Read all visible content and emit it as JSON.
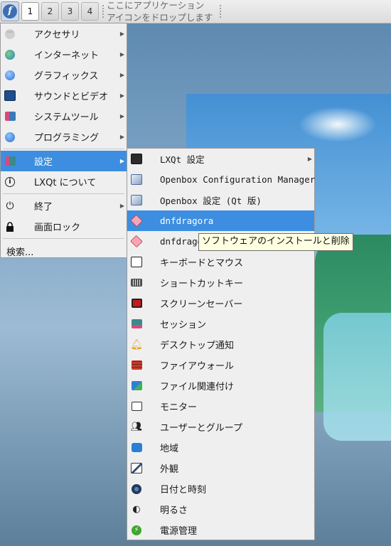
{
  "panel": {
    "desktops": [
      "1",
      "2",
      "3",
      "4"
    ],
    "active_desktop": "1",
    "quicklaunch_hint_line1": "ここにアプリケーション",
    "quicklaunch_hint_line2": "アイコンをドロップします"
  },
  "main_menu": {
    "items": [
      {
        "label": "アクセサリ",
        "icon": "accessories-icon",
        "submenu": true
      },
      {
        "label": "インターネット",
        "icon": "globe-icon",
        "submenu": true
      },
      {
        "label": "グラフィックス",
        "icon": "graphics-icon",
        "submenu": true
      },
      {
        "label": "サウンドとビデオ",
        "icon": "multimedia-icon",
        "submenu": true
      },
      {
        "label": "システムツール",
        "icon": "system-tools-icon",
        "submenu": true
      },
      {
        "label": "プログラミング",
        "icon": "programming-icon",
        "submenu": true
      },
      {
        "label": "設定",
        "icon": "settings-icon",
        "submenu": true
      },
      {
        "label": "LXQt について",
        "icon": "info-icon",
        "submenu": false
      },
      {
        "label": "終了",
        "icon": "power-icon",
        "submenu": true
      },
      {
        "label": "画面ロック",
        "icon": "lock-icon",
        "submenu": false
      }
    ],
    "search_label": "検索..."
  },
  "settings_menu": {
    "items": [
      {
        "label": "LXQt 設定",
        "icon": "lxqt-settings-icon",
        "submenu": true
      },
      {
        "label": "Openbox Configuration Manager",
        "icon": "openbox-config-icon",
        "submenu": false
      },
      {
        "label": "Openbox 設定 (Qt 版)",
        "icon": "openbox-qt-icon",
        "submenu": false
      },
      {
        "label": "dnfdragora",
        "icon": "dnfdragora-icon",
        "submenu": false
      },
      {
        "label": "dnfdragora",
        "icon": "dnfdragora-updater-icon",
        "submenu": false
      },
      {
        "label": "キーボードとマウス",
        "icon": "keyboard-mouse-icon",
        "submenu": false
      },
      {
        "label": "ショートカットキー",
        "icon": "shortcut-keys-icon",
        "submenu": false
      },
      {
        "label": "スクリーンセーバー",
        "icon": "screensaver-icon",
        "submenu": false
      },
      {
        "label": "セッション",
        "icon": "session-icon",
        "submenu": false
      },
      {
        "label": "デスクトップ通知",
        "icon": "bell-icon",
        "submenu": false
      },
      {
        "label": "ファイアウォール",
        "icon": "firewall-icon",
        "submenu": false
      },
      {
        "label": "ファイル関連付け",
        "icon": "file-association-icon",
        "submenu": false
      },
      {
        "label": "モニター",
        "icon": "monitor-icon",
        "submenu": false
      },
      {
        "label": "ユーザーとグループ",
        "icon": "users-icon",
        "submenu": false
      },
      {
        "label": "地域",
        "icon": "locale-icon",
        "submenu": false
      },
      {
        "label": "外観",
        "icon": "appearance-icon",
        "submenu": false
      },
      {
        "label": "日付と時刻",
        "icon": "clock-icon",
        "submenu": false
      },
      {
        "label": "明るさ",
        "icon": "brightness-icon",
        "submenu": false
      },
      {
        "label": "電源管理",
        "icon": "power-management-icon",
        "submenu": false
      }
    ]
  },
  "tooltip": "ソフトウェアのインストールと削除",
  "colors": {
    "selection": "#3d8ee0",
    "menu_bg": "#efefef",
    "tooltip_bg": "#ffffe1"
  }
}
